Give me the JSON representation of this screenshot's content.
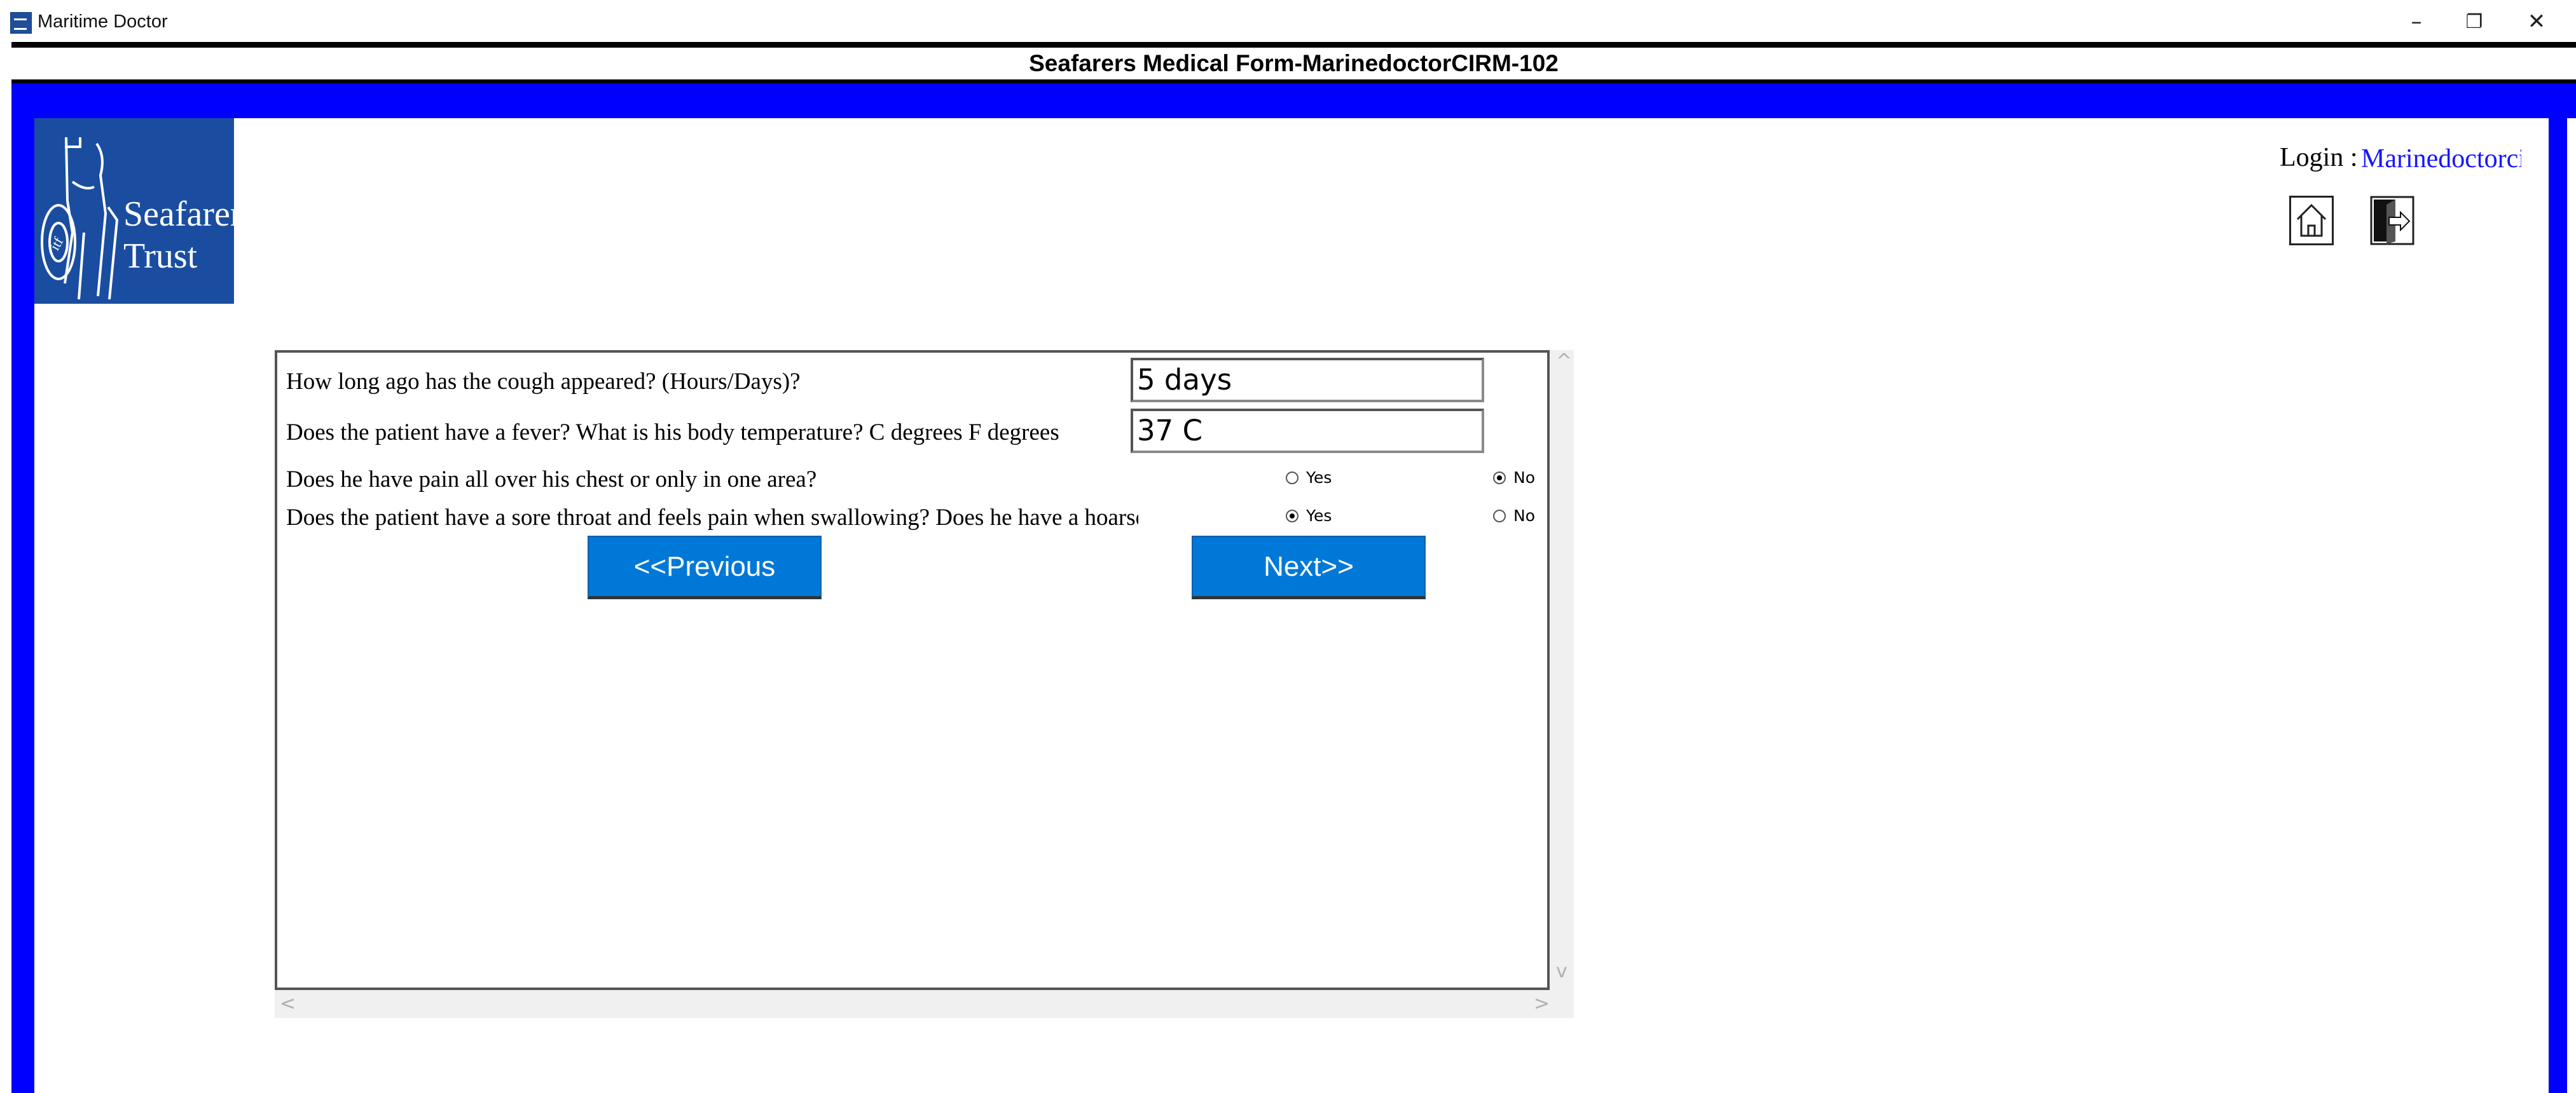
{
  "window": {
    "app_title": "Maritime Doctor",
    "minimize": "–",
    "maximize": "❐",
    "close": "✕"
  },
  "form": {
    "header": "Seafarers Medical Form-MarinedoctorCIRM-102"
  },
  "logo": {
    "line1": "Seafarers'",
    "line2": "Trust"
  },
  "login": {
    "label": "Login :",
    "user": "Marinedoctorcirm"
  },
  "icons": {
    "home": "home-icon",
    "logout": "logout-icon"
  },
  "questions": [
    {
      "text": "How long ago has the cough appeared? (Hours/Days)?",
      "value": "5 days"
    },
    {
      "text": "Does the patient have a fever? What is his body temperature? C degrees F degrees",
      "value": "37 C"
    },
    {
      "text": "Does he have pain all over his chest or only in one area?",
      "yes": "Yes",
      "no": "No",
      "selected": "No"
    },
    {
      "text": "Does the patient have a sore throat and feels pain when swallowing? Does he have a hoarse voice?",
      "yes": "Yes",
      "no": "No",
      "selected": "Yes"
    }
  ],
  "buttons": {
    "previous": "<<Previous",
    "next": "Next>>"
  },
  "scroll": {
    "up": "^",
    "down": "v",
    "left": "<",
    "right": ">"
  },
  "colors": {
    "frame_blue": "#0000ff",
    "button_blue": "#0078d7",
    "login_blue": "#1515ff",
    "logo_blue": "#1a4da0"
  }
}
